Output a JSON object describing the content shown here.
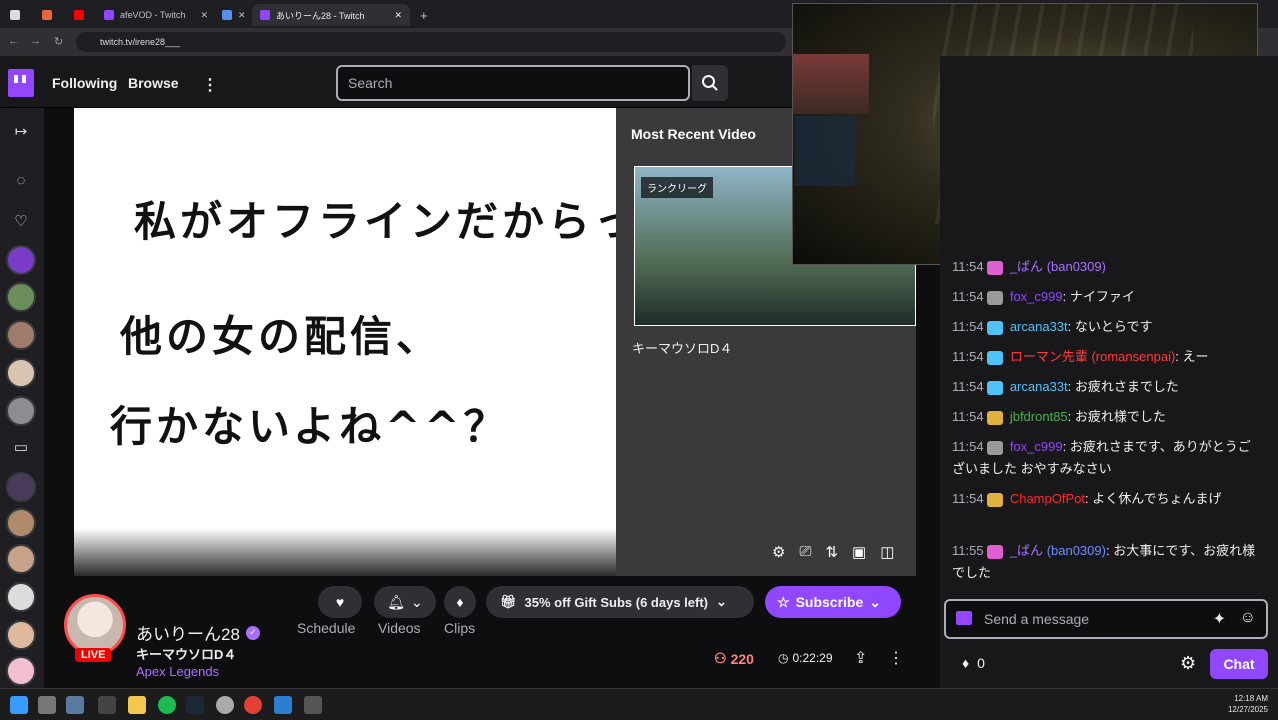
{
  "browser": {
    "tabs": [
      {
        "label": ""
      },
      {
        "label": ""
      },
      {
        "label": "afeVOD - Twitch"
      },
      {
        "label": ""
      },
      {
        "label": "あいりーん28 - Twitch"
      }
    ],
    "url": "twitch.tv/irene28___"
  },
  "nav": {
    "following": "Following",
    "browse": "Browse",
    "search_placeholder": "Search"
  },
  "player": {
    "lines": [
      "私がオフラインだからっ",
      "他の女の配信、",
      "行かないよね^^？"
    ]
  },
  "recent": {
    "title": "Most Recent Video",
    "badge": "ランクリーグ",
    "name": "キーマウソロD４"
  },
  "channel": {
    "name": "あいりーん28",
    "live": "LIVE",
    "stream_title": "キーマウソロD４",
    "game": "Apex Legends",
    "tabs": {
      "schedule": "Schedule",
      "videos": "Videos",
      "clips": "Clips"
    },
    "gift": "35% off Gift Subs (6 days left)",
    "subscribe": "Subscribe",
    "viewers": "220",
    "uptime": "0:22:29"
  },
  "chat": {
    "messages": [
      {
        "time": "11:54",
        "user": "_ばん",
        "alt": "(ban0309)",
        "text": "",
        "color": "#a970ff"
      },
      {
        "time": "11:54",
        "user": "fox_c999",
        "alt": "",
        "text": ": ナイファイ",
        "color": "#9147ff"
      },
      {
        "time": "11:54",
        "user": "arcana33t",
        "alt": "",
        "text": ": ないとらです",
        "color": "#4fc3f7"
      },
      {
        "time": "11:54",
        "user": "ローマン先輩",
        "alt": "(romansenpai)",
        "text": ": えー",
        "color": "#ff3b3b"
      },
      {
        "time": "11:54",
        "user": "arcana33t",
        "alt": "",
        "text": ": お疲れさまでした",
        "color": "#4fc3f7"
      },
      {
        "time": "11:54",
        "user": "jbfdront85",
        "alt": "",
        "text": ": お疲れ様でした",
        "color": "#4caf50"
      },
      {
        "time": "11:54",
        "user": "fox_c999",
        "alt": "",
        "text": ": お疲れさまです、ありがとうございました おやすみなさい",
        "color": "#9147ff"
      },
      {
        "time": "11:54",
        "user": "ChampOfPot",
        "alt": "",
        "text": ": よく休んでちょんまげ",
        "color": "#ff2a2a"
      },
      {
        "time": "11:55",
        "user": "_ばん",
        "alt": "(ban0309)",
        "text": ": お大事にです、お疲れ様でした",
        "color": "#a970ff"
      }
    ],
    "input_placeholder": "Send a message",
    "points": "0",
    "send": "Chat"
  },
  "taskbar": {
    "time": "12:18 AM",
    "date": "12/27/2025"
  }
}
